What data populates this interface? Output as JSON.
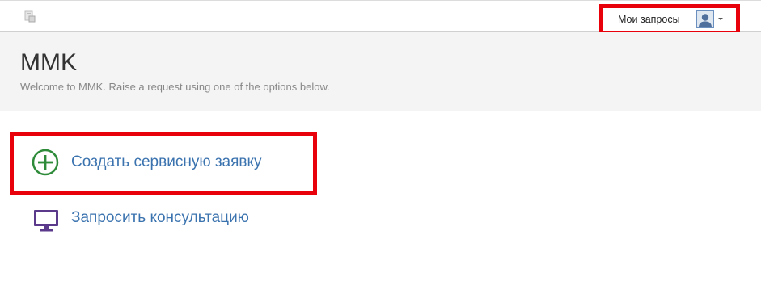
{
  "topbar": {
    "logo_icon": "help-center-logo-icon",
    "my_requests_label": "Мои запросы",
    "avatar_icon": "user-avatar-icon",
    "dropdown_icon": "caret-down-icon"
  },
  "header": {
    "title": "MMK",
    "subtitle": "Welcome to MMK. Raise a request using one of the options below."
  },
  "options": [
    {
      "label": "Создать сервисную заявку",
      "icon": "plus-circle-icon",
      "icon_color": "#2e8b3a"
    },
    {
      "label": "Запросить консультацию",
      "icon": "monitor-icon",
      "icon_color": "#5b3a8c"
    }
  ],
  "colors": {
    "link": "#3b73af",
    "highlight": "#e8000b"
  }
}
